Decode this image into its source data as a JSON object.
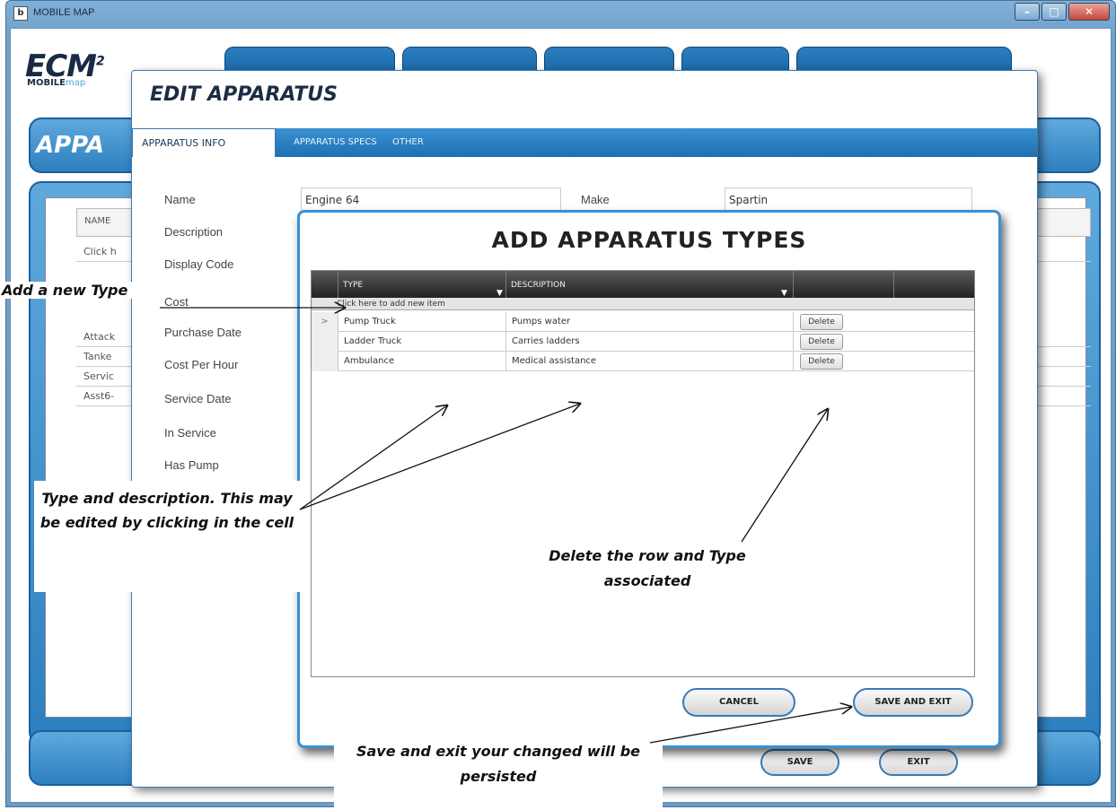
{
  "window": {
    "title": "MOBILE MAP",
    "icon_glyph": "b"
  },
  "logo": {
    "main": "ECM",
    "sup": "2",
    "sub_bold": "MOBILE",
    "sub_light": "map"
  },
  "background_page": {
    "banner_title": "APPA",
    "grid_header": "NAME",
    "rows": [
      "Click h",
      "Attack",
      "Tanke",
      "Servic",
      "Asst6-"
    ]
  },
  "edit_dialog": {
    "title": "EDIT APPARATUS",
    "tabs": [
      "APPARATUS INFO",
      "APPARATUS SPECS",
      "OTHER"
    ],
    "labels": [
      "Name",
      "Description",
      "Display Code",
      "Cost",
      "Purchase Date",
      "Cost Per Hour",
      "Service Date",
      "In Service",
      "Has Pump"
    ],
    "name_value": "Engine 64",
    "make_label": "Make",
    "make_value": "Spartin",
    "buttons": {
      "save": "SAVE",
      "exit": "EXIT"
    }
  },
  "add_dialog": {
    "title": "ADD APPARATUS TYPES",
    "columns": [
      "TYPE",
      "DESCRIPTION"
    ],
    "new_item_text": "Click here to add new item",
    "rows": [
      {
        "selector": ">",
        "type": "Pump Truck",
        "description": "Pumps water",
        "action": "Delete"
      },
      {
        "selector": "",
        "type": "Ladder Truck",
        "description": "Carries ladders",
        "action": "Delete"
      },
      {
        "selector": "",
        "type": "Ambulance",
        "description": "Medical assistance",
        "action": "Delete"
      }
    ],
    "buttons": {
      "cancel": "CANCEL",
      "save_exit": "SAVE AND EXIT"
    }
  },
  "annotations": {
    "add_type": "Add a new Type",
    "type_desc": "Type and description. This may be edited by clicking in the cell",
    "delete": "Delete the row and Type associated",
    "save": "Save and exit your changed will be persisted"
  },
  "colors": {
    "accent": "#2d7fbf",
    "dialog_border": "#3a91d2",
    "grid_header": "#333333"
  }
}
